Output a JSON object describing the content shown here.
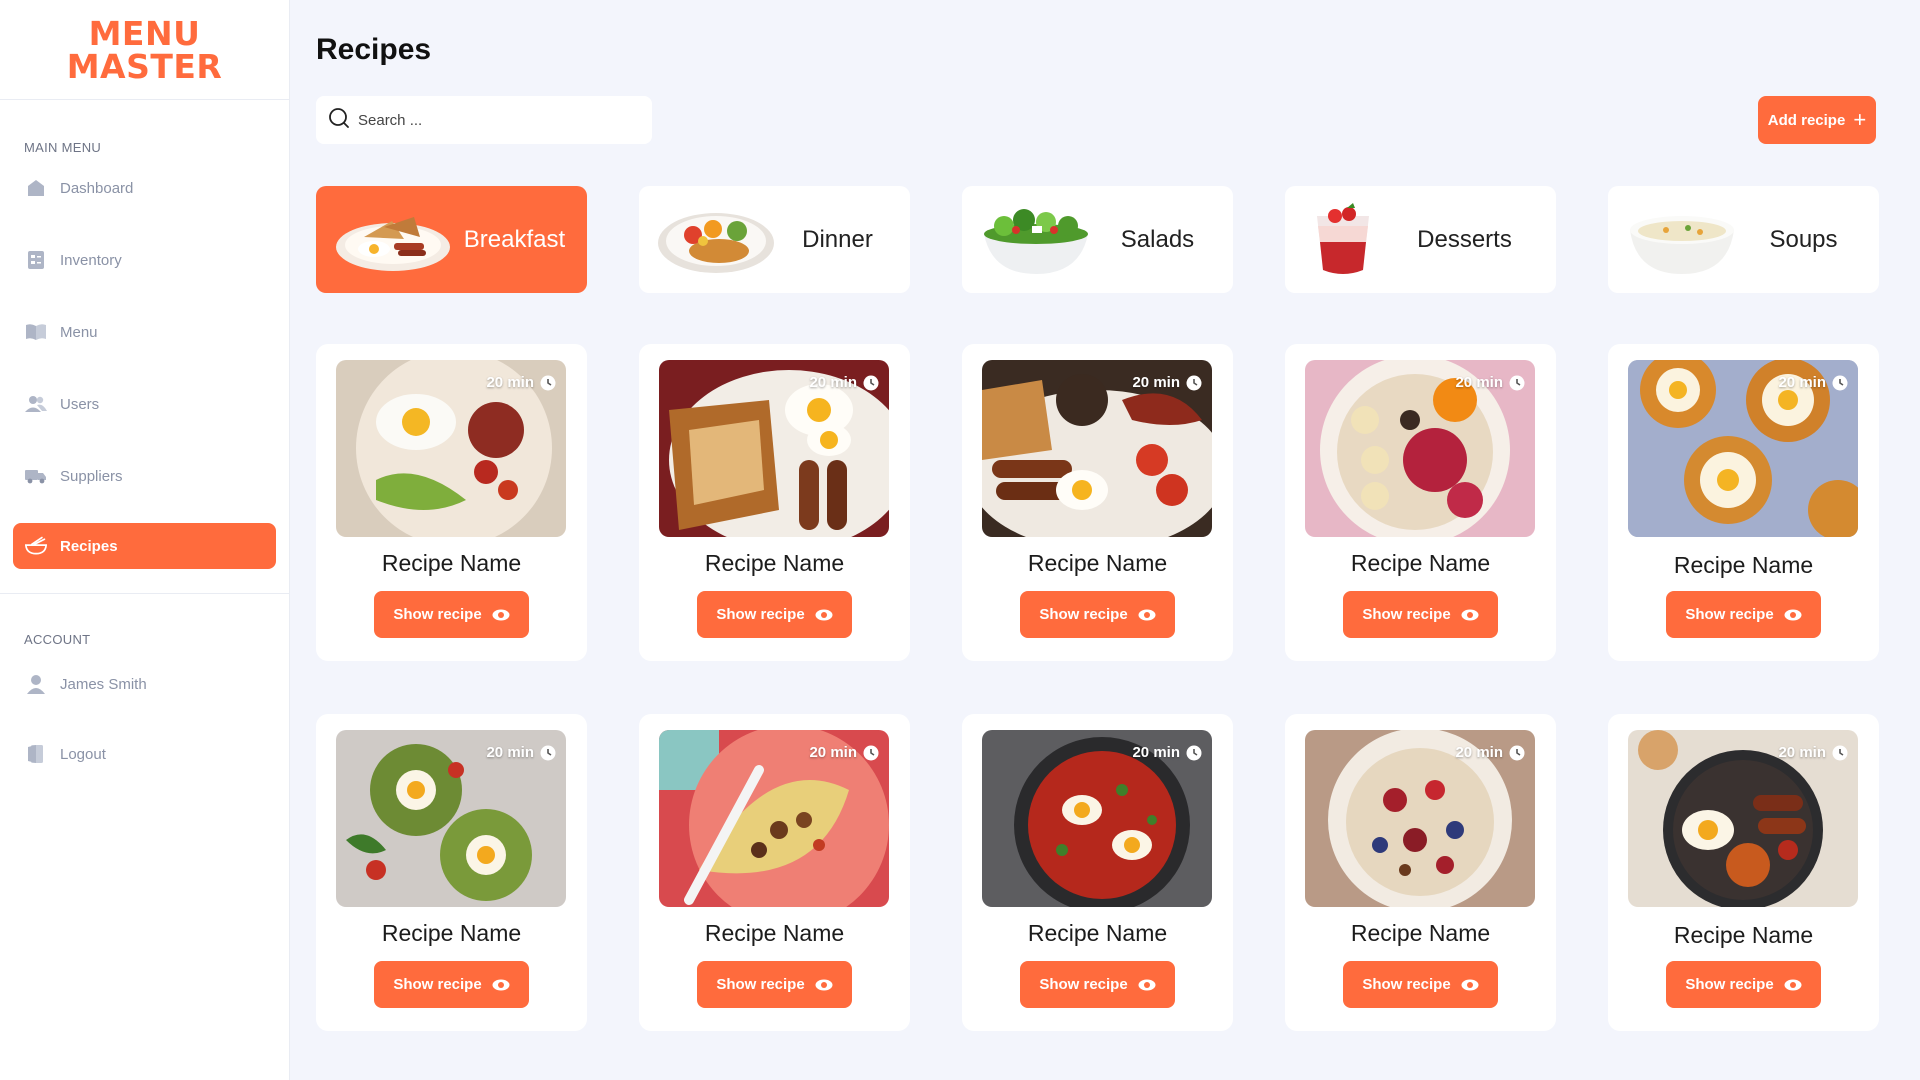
{
  "brand": {
    "line1": "MENU",
    "line2": "MASTER",
    "accent": "#ff6b3d"
  },
  "sidebar": {
    "main_label": "MAIN MENU",
    "items": [
      {
        "label": "Dashboard",
        "icon": "home-icon"
      },
      {
        "label": "Inventory",
        "icon": "inventory-icon"
      },
      {
        "label": "Menu",
        "icon": "book-icon"
      },
      {
        "label": "Users",
        "icon": "users-icon"
      },
      {
        "label": "Suppliers",
        "icon": "truck-icon"
      },
      {
        "label": "Recipes",
        "icon": "recipe-bowl-icon",
        "active": true
      }
    ],
    "account_label": "ACCOUNT",
    "account_items": [
      {
        "label": "James Smith",
        "icon": "user-icon"
      },
      {
        "label": "Logout",
        "icon": "logout-icon"
      }
    ]
  },
  "header": {
    "title": "Recipes",
    "search_placeholder": "Search ...",
    "add_label": "Add recipe"
  },
  "categories": [
    {
      "label": "Breakfast",
      "active": true
    },
    {
      "label": "Dinner"
    },
    {
      "label": "Salads"
    },
    {
      "label": "Desserts"
    },
    {
      "label": "Soups"
    }
  ],
  "recipes": [
    {
      "name": "Recipe Name",
      "time": "20 min",
      "button": "Show recipe"
    },
    {
      "name": "Recipe Name",
      "time": "20 min",
      "button": "Show recipe"
    },
    {
      "name": "Recipe Name",
      "time": "20 min",
      "button": "Show recipe"
    },
    {
      "name": "Recipe Name",
      "time": "20 min",
      "button": "Show recipe"
    },
    {
      "name": "Recipe Name",
      "time": "20 min",
      "button": "Show recipe"
    },
    {
      "name": "Recipe Name",
      "time": "20 min",
      "button": "Show recipe"
    },
    {
      "name": "Recipe Name",
      "time": "20 min",
      "button": "Show recipe"
    },
    {
      "name": "Recipe Name",
      "time": "20 min",
      "button": "Show recipe"
    },
    {
      "name": "Recipe Name",
      "time": "20 min",
      "button": "Show recipe"
    },
    {
      "name": "Recipe Name",
      "time": "20 min",
      "button": "Show recipe"
    }
  ]
}
